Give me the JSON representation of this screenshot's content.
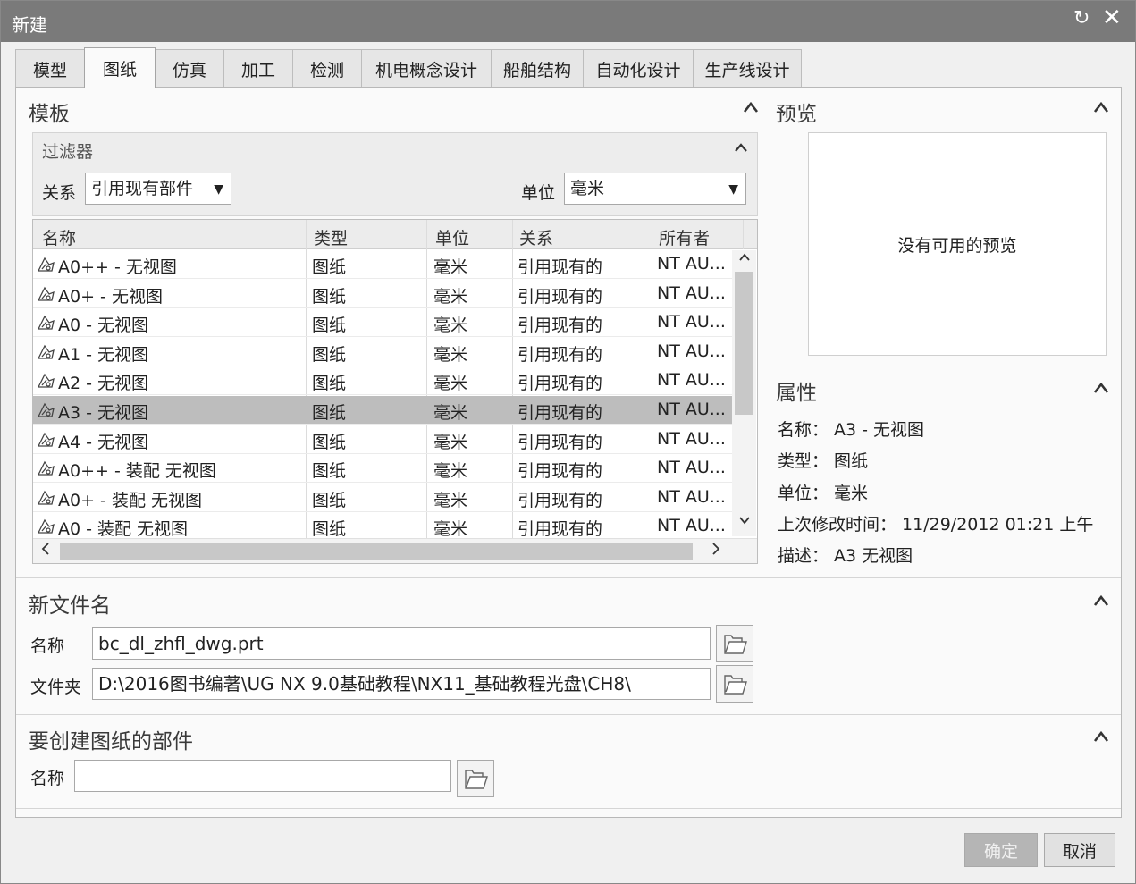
{
  "window": {
    "title": "新建",
    "reset_icon": "↻",
    "close_icon": "✕"
  },
  "tabs": [
    {
      "label": "模型",
      "active": false
    },
    {
      "label": "图纸",
      "active": true
    },
    {
      "label": "仿真",
      "active": false
    },
    {
      "label": "加工",
      "active": false
    },
    {
      "label": "检测",
      "active": false
    },
    {
      "label": "机电概念设计",
      "active": false
    },
    {
      "label": "船舶结构",
      "active": false
    },
    {
      "label": "自动化设计",
      "active": false
    },
    {
      "label": "生产线设计",
      "active": false
    }
  ],
  "template": {
    "title": "模板",
    "filter": {
      "title": "过滤器",
      "relation_label": "关系",
      "relation_value": "引用现有部件",
      "unit_label": "单位",
      "unit_value": "毫米"
    },
    "columns": [
      "名称",
      "类型",
      "单位",
      "关系",
      "所有者"
    ],
    "rows": [
      {
        "name": "A0++ - 无视图",
        "type": "图纸",
        "unit": "毫米",
        "relation": "引用现有的",
        "owner": "NT AU...",
        "selected": false
      },
      {
        "name": "A0+ - 无视图",
        "type": "图纸",
        "unit": "毫米",
        "relation": "引用现有的",
        "owner": "NT AU...",
        "selected": false
      },
      {
        "name": "A0 - 无视图",
        "type": "图纸",
        "unit": "毫米",
        "relation": "引用现有的",
        "owner": "NT AU...",
        "selected": false
      },
      {
        "name": "A1 - 无视图",
        "type": "图纸",
        "unit": "毫米",
        "relation": "引用现有的",
        "owner": "NT AU...",
        "selected": false
      },
      {
        "name": "A2 - 无视图",
        "type": "图纸",
        "unit": "毫米",
        "relation": "引用现有的",
        "owner": "NT AU...",
        "selected": false
      },
      {
        "name": "A3 - 无视图",
        "type": "图纸",
        "unit": "毫米",
        "relation": "引用现有的",
        "owner": "NT AU...",
        "selected": true
      },
      {
        "name": "A4 - 无视图",
        "type": "图纸",
        "unit": "毫米",
        "relation": "引用现有的",
        "owner": "NT AU...",
        "selected": false
      },
      {
        "name": "A0++ - 装配 无视图",
        "type": "图纸",
        "unit": "毫米",
        "relation": "引用现有的",
        "owner": "NT AU...",
        "selected": false
      },
      {
        "name": "A0+ - 装配 无视图",
        "type": "图纸",
        "unit": "毫米",
        "relation": "引用现有的",
        "owner": "NT AU...",
        "selected": false
      },
      {
        "name": "A0 - 装配 无视图",
        "type": "图纸",
        "unit": "毫米",
        "relation": "引用现有的",
        "owner": "NT AU...",
        "selected": false
      }
    ]
  },
  "preview": {
    "title": "预览",
    "message": "没有可用的预览"
  },
  "properties": {
    "title": "属性",
    "name_line": "名称： A3 - 无视图",
    "type_line": "类型： 图纸",
    "unit_line": "单位： 毫米",
    "modified_line": "上次修改时间： 11/29/2012 01:21 上午",
    "desc_line": "描述： A3 无视图"
  },
  "new_file": {
    "title": "新文件名",
    "name_label": "名称",
    "name_value": "bc_dl_zhfl_dwg.prt",
    "folder_label": "文件夹",
    "folder_value": "D:\\2016图书编著\\UG NX 9.0基础教程\\NX11_基础教程光盘\\CH8\\"
  },
  "part": {
    "title": "要创建图纸的部件",
    "name_label": "名称",
    "name_value": ""
  },
  "buttons": {
    "ok": "确定",
    "cancel": "取消"
  }
}
